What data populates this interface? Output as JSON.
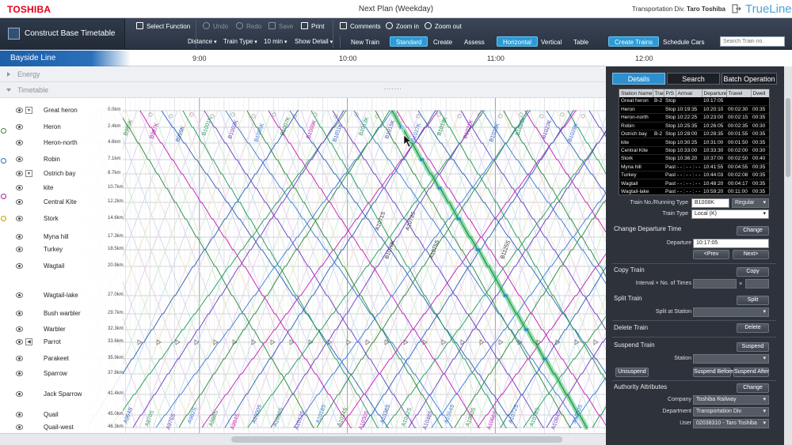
{
  "brand": {
    "company": "TOSHIBA",
    "product": "TrueLine"
  },
  "doc_title": "Next Plan (Weekday)",
  "user": {
    "division": "Transportation Div.",
    "name": "Taro Toshiba"
  },
  "app_title": "Construct Base Timetable",
  "toolbar": {
    "select_function": "Select Function",
    "undo": "Undo",
    "redo": "Redo",
    "save": "Save",
    "print": "Print",
    "comments": "Comments",
    "zoom_in": "Zoom in",
    "zoom_out": "Zoom out",
    "distance": "Distance",
    "train_type": "Train Type",
    "interval": "10 min",
    "show_detail": "Show Detail",
    "new_train": "New Train",
    "standard": "Standard",
    "create": "Create",
    "assess": "Assess",
    "horizontal": "Horizontal",
    "vertical": "Vertical",
    "table": "Table",
    "create_trains": "Create Trains",
    "schedule_cars": "Schedule Cars",
    "search_placeholder": "Search Train no."
  },
  "line_name": "Bayside Line",
  "hours": [
    "9:00",
    "10:00",
    "11:00",
    "12:00"
  ],
  "sections": {
    "energy": "Energy",
    "timetable": "Timetable"
  },
  "stations": [
    {
      "name": "Great heron",
      "km": "0.0km"
    },
    {
      "name": "Heron",
      "km": "2.4km"
    },
    {
      "name": "Heron-north",
      "km": "4.6km"
    },
    {
      "name": "Robin",
      "km": "7.1km"
    },
    {
      "name": "Ostrich bay",
      "km": "8.7km"
    },
    {
      "name": "kite",
      "km": "10.7km"
    },
    {
      "name": "Central Kite",
      "km": "12.2km"
    },
    {
      "name": "Stork",
      "km": "14.6km"
    },
    {
      "name": "Myna hill",
      "km": "17.3km"
    },
    {
      "name": "Turkey",
      "km": "18.5km"
    },
    {
      "name": "Wagtail",
      "km": "20.9km"
    },
    {
      "name": "Wagtail-lake",
      "km": "27.0km"
    },
    {
      "name": "Bush warbler",
      "km": "29.7km"
    },
    {
      "name": "Warbler",
      "km": "32.3km"
    },
    {
      "name": "Parrot",
      "km": "33.6km"
    },
    {
      "name": "Parakeet",
      "km": "35.9km"
    },
    {
      "name": "Sparrow",
      "km": "37.8km"
    },
    {
      "name": "Jack Sparrow",
      "km": "41.4km"
    },
    {
      "name": "Quail",
      "km": "45.0km"
    },
    {
      "name": "Quail-west",
      "km": "46.3km"
    }
  ],
  "train_labels": {
    "upper": [
      "B995K",
      "B997K",
      "B999K",
      "B1001K",
      "B1003K",
      "B1005K",
      "B1007K",
      "B1009K",
      "B1011K",
      "B1013K",
      "B1015K",
      "B1017K",
      "B1019K",
      "B1021K",
      "B1023K",
      "B1025K",
      "B1027K",
      "B1029K"
    ],
    "middle": [
      "A1071S",
      "A1073S",
      "B1070K",
      "A1075S",
      "B1125S"
    ],
    "lower": [
      "A964S",
      "A970S",
      "A976S",
      "A982S",
      "A988S",
      "A994S",
      "A1000S",
      "A1006S",
      "A1012S",
      "A1018S",
      "A1024S",
      "A1030S",
      "A1036S",
      "A1042S",
      "A1048S",
      "A1054S",
      "A1060S",
      "A1066S",
      "A1072S",
      "A1078S",
      "A1084S",
      "A1090S"
    ]
  },
  "panel": {
    "tabs": [
      "Details",
      "Search",
      "Batch Operation"
    ],
    "table": {
      "headers": [
        "Station Name",
        "Track",
        "P/S",
        "Arrival",
        "Departure",
        "Travel",
        "Dwell"
      ],
      "rows": [
        [
          "Great heron",
          "B-2",
          "Stop",
          "",
          "10:17:05",
          "",
          ""
        ],
        [
          "Heron",
          "",
          "Stop",
          "10:19:35",
          "10:20:10",
          "00:02:30",
          "00:35"
        ],
        [
          "Heron-north",
          "",
          "Stop",
          "10:22:25",
          "10:23:00",
          "00:02:15",
          "00:35"
        ],
        [
          "Robin",
          "",
          "Stop",
          "10:25:35",
          "10:26:05",
          "00:02:35",
          "00:30"
        ],
        [
          "Ostrich bay",
          "B-2",
          "Stop",
          "10:28:00",
          "10:28:35",
          "00:01:55",
          "00:35"
        ],
        [
          "kite",
          "",
          "Stop",
          "10:30:25",
          "10:31:00",
          "00:01:50",
          "00:35"
        ],
        [
          "Central Kite",
          "",
          "Stop",
          "10:33:00",
          "10:33:30",
          "00:02:00",
          "00:30"
        ],
        [
          "Stork",
          "",
          "Stop",
          "10:36:20",
          "10:37:00",
          "00:02:50",
          "00:40"
        ],
        [
          "Myna hill",
          "",
          "Past",
          "- - : - - : - -",
          "10:41:55",
          "00:04:55",
          "00:35"
        ],
        [
          "Turkey",
          "",
          "Past",
          "- - : - - : - -",
          "10:44:03",
          "00:02:08",
          "00:35"
        ],
        [
          "Wagtail",
          "",
          "Past",
          "- - : - - : - -",
          "10:48:20",
          "00:04:17",
          "00:35"
        ],
        [
          "Wagtail-lake",
          "",
          "Past",
          "- - : - - : - -",
          "10:59:20",
          "00:11:00",
          "00:35"
        ]
      ]
    },
    "train_no_label": "Train No./Running Type",
    "train_no": "B1008K",
    "running_type": "Regular",
    "train_type_label": "Train Type",
    "train_type": "Local (K)",
    "change_departure": {
      "title": "Change Departure Time",
      "button": "Change",
      "departure_label": "Departure",
      "departure": "10:17:05",
      "prev": "<Prev",
      "next": "Next>"
    },
    "copy_train": {
      "title": "Copy Train",
      "button": "Copy",
      "interval_label": "Interval × No. of Times",
      "times_sign": "×"
    },
    "split_train": {
      "title": "Split Train",
      "button": "Split",
      "at_label": "Split at Station"
    },
    "delete_train": {
      "title": "Delete Train",
      "button": "Delete"
    },
    "suspend_train": {
      "title": "Suspend Train",
      "button": "Suspend",
      "station_label": "Station",
      "unsuspend": "Unsuspend",
      "before": "Suspend Before",
      "after": "Suspend After"
    },
    "authority": {
      "title": "Authority Attributes",
      "button": "Change",
      "company_label": "Company",
      "company": "Toshiba Railway",
      "department_label": "Department",
      "department": "Transportation Div.",
      "user_label": "User",
      "user": "02038310 - Taro Toshiba"
    }
  },
  "colors": {
    "accent": "#2a9bd6",
    "selected_train": "#3ec46d",
    "panel_bg": "#2e333b",
    "brand_red": "#e2001a",
    "trueline_blue": "#4aa3d8"
  }
}
